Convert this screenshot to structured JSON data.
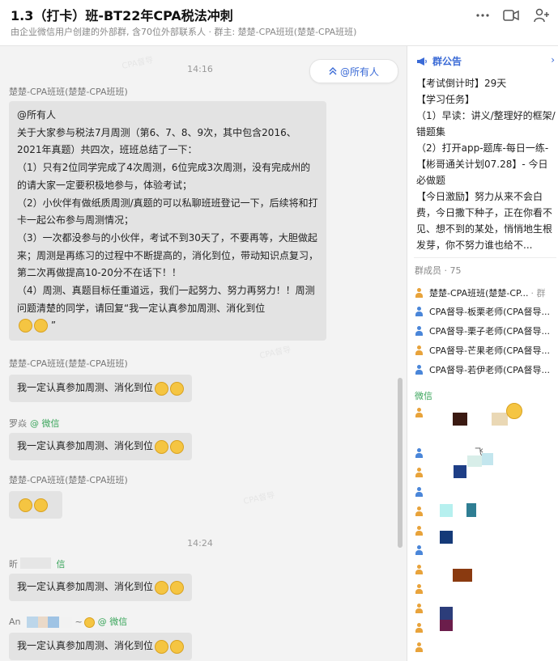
{
  "header": {
    "title": "1.3（打卡）班-BT22年CPA税法冲刺",
    "subtitle": "由企业微信用户创建的外部群, 含70位外部联系人 · 群主: 楚楚-CPA班班(楚楚-CPA班班)",
    "icons": [
      "more-icon",
      "video-call-icon",
      "add-member-icon"
    ]
  },
  "chat": {
    "mention_button": "@所有人",
    "time1": "14:16",
    "time2": "14:24",
    "messages": [
      {
        "sender": "楚楚-CPA班班(楚楚-CPA班班)",
        "lines": [
          "@所有人",
          "关于大家参与税法7月周测（第6、7、8、9次，其中包含2016、2021年真题）共四次，班班总结了一下：",
          "（1）只有2位同学完成了4次周测，6位完成3次周测，没有完成州的的请大家一定要积极地参与，体验考试；",
          "（2）小伙伴有做纸质周测/真题的可以私聊班班登记一下，后续将和打卡一起公布参与周测情况；",
          "（3）一次都没参与的小伙伴，考试不到30天了，不要再等，大胆做起来；周测是再练习的过程中不断提高的，消化到位，带动知识点复习，第二次再做提高10-20分不在话下！！",
          "（4）周测、真题目标任重道远，我们一起努力、努力再努力！！周测问题清楚的同学，请回复“我一定认真参加周测、消化到位"
        ],
        "closing_quote": "”"
      },
      {
        "sender": "楚楚-CPA班班(楚楚-CPA班班)",
        "text": "我一定认真参加周测、消化到位"
      },
      {
        "sender": "罗焱",
        "channel": "@ 微信",
        "text": "我一定认真参加周测、消化到位"
      },
      {
        "sender": "楚楚-CPA班班(楚楚-CPA班班)",
        "text": ""
      },
      {
        "sender": "昕",
        "channel": "信",
        "text": "我一定认真参加周测、消化到位"
      },
      {
        "sender": "An",
        "channel": "@ 微信",
        "extra": "~",
        "text": "我一定认真参加周测、消化到位"
      }
    ]
  },
  "sidebar": {
    "announcement_title": "群公告",
    "announcement_lines": [
      "【考试倒计时】29天",
      "【学习任务】",
      "（1）早读：讲义/整理好的框架/错题集",
      "（2）打开app-题库-每日一练-",
      "【彬哥通关计划07.28】- 今日必做题",
      "【今日激励】努力从来不会白费，今日撒下种子，正在你看不见、想不到的某处，悄悄地生根发芽，你不努力谁也给不..."
    ],
    "members_header": "群成员 · 75",
    "members": [
      {
        "name": "楚楚-CPA班班(楚楚-CP...",
        "suffix": "· 群"
      },
      {
        "name": "CPA督导-板栗老师(CPA督导..."
      },
      {
        "name": "CPA督导-栗子老师(CPA督导..."
      },
      {
        "name": "CPA督导-芒果老师(CPA督导..."
      },
      {
        "name": "CPA督导-若伊老师(CPA督导..."
      }
    ],
    "wechat_label": "微信",
    "wechat_partial_name": "飞"
  },
  "colors": {
    "accent": "#3a6ad6",
    "wechat_green": "#3aa55b",
    "bubble": "#e3e3e3",
    "chat_bg": "#f3f3f3"
  }
}
